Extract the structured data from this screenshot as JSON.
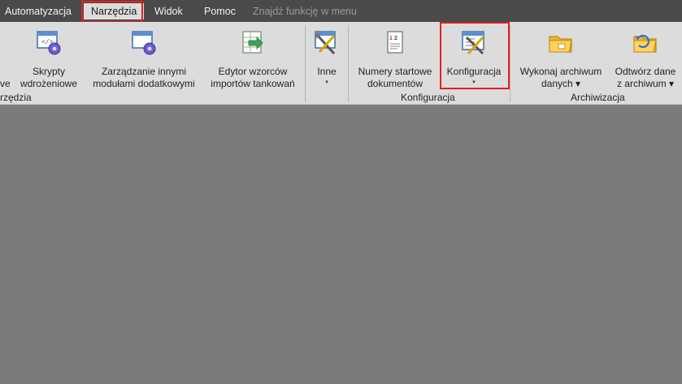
{
  "menu": {
    "items": [
      "Automatyzacja",
      "Narzędzia",
      "Widok",
      "Pomoc"
    ],
    "search_placeholder": "Znajdź funkcję w menu"
  },
  "ribbon": {
    "buttons": [
      {
        "label_lines": [
          "",
          "ve"
        ]
      },
      {
        "label_lines": [
          "Skrypty",
          "wdrożeniowe"
        ]
      },
      {
        "label_lines": [
          "Zarządzanie innymi",
          "modułami dodatkowymi"
        ]
      },
      {
        "label_lines": [
          "Edytor wzorców",
          "importów tankowań"
        ]
      },
      {
        "label_lines": [
          "Inne",
          "▾"
        ]
      },
      {
        "label_lines": [
          "Numery startowe",
          "dokumentów"
        ]
      },
      {
        "label_lines": [
          "Konfiguracja",
          "▾"
        ]
      },
      {
        "label_lines": [
          "Wykonaj archiwum",
          "danych ▾"
        ]
      },
      {
        "label_lines": [
          "Odtwórz dane",
          "z archiwum ▾"
        ]
      }
    ],
    "groups": [
      "rzędzia",
      "Konfiguracja",
      "Archiwizacja"
    ]
  },
  "colors": {
    "menubar_bg": "#4a4a4a",
    "ribbon_bg": "#dcdcdc",
    "workspace_bg": "#7b7b7b",
    "highlight": "#e02020"
  }
}
